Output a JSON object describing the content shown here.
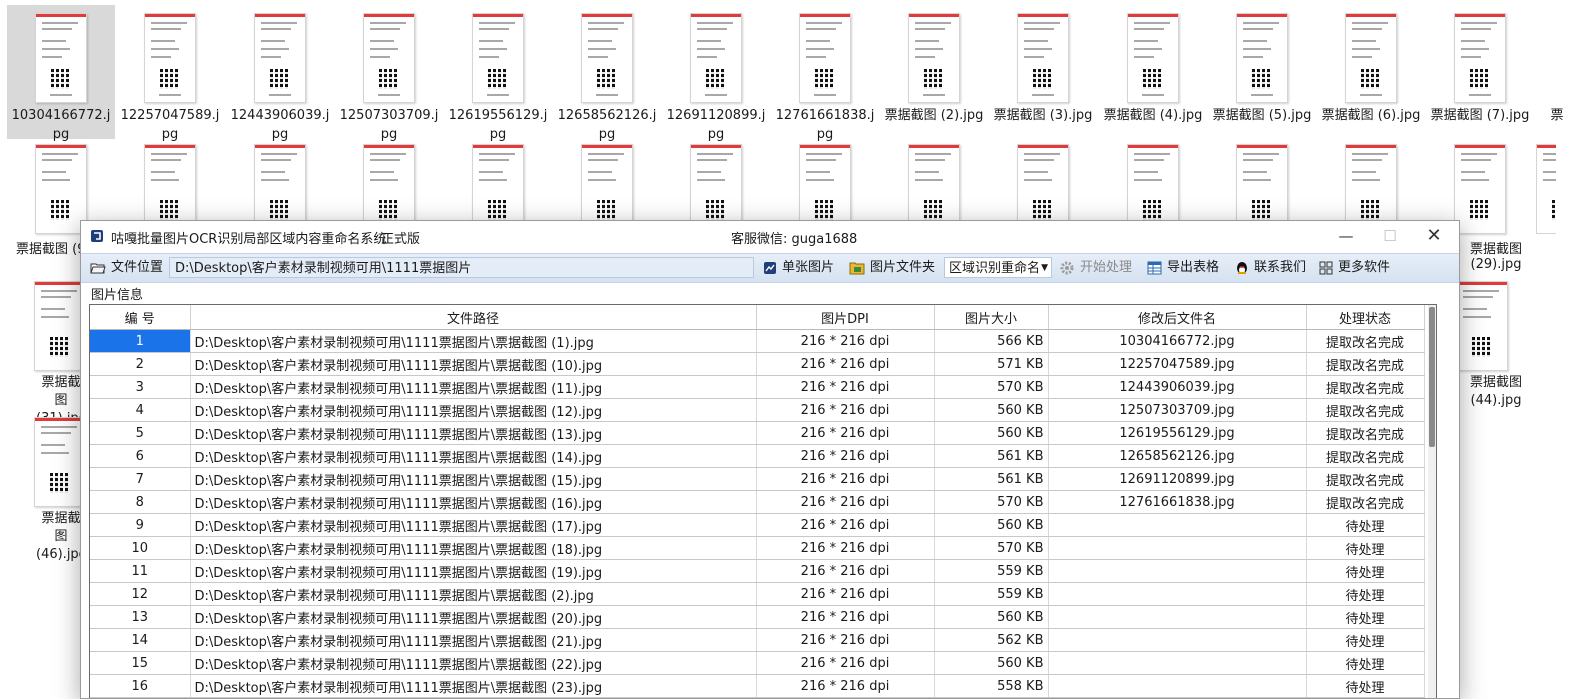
{
  "explorer": {
    "row1": [
      {
        "name": "10304166772.jpg",
        "selected": true
      },
      {
        "name": "12257047589.jpg"
      },
      {
        "name": "12443906039.jpg"
      },
      {
        "name": "12507303709.jpg"
      },
      {
        "name": "12619556129.jpg"
      },
      {
        "name": "12658562126.jpg"
      },
      {
        "name": "12691120899.jpg"
      },
      {
        "name": "12761661838.jpg"
      },
      {
        "name": "票据截图 (2).jpg"
      },
      {
        "name": "票据截图 (3).jpg"
      },
      {
        "name": "票据截图 (4).jpg"
      },
      {
        "name": "票据截图 (5).jpg"
      },
      {
        "name": "票据截图 (6).jpg"
      },
      {
        "name": "票据截图 (7).jpg"
      },
      {
        "name": "票"
      }
    ],
    "row2_left_label": "票据截图 (9",
    "row2_right_label": "票据截图 (29).jpg",
    "row3_left_label": "票据截图 (31).jpg",
    "row3_right_label": "票据截图 (44).jpg",
    "row4_left_label": "票据截图 (46).jpg"
  },
  "dialog": {
    "title": "咕嘎批量图片OCR识别局部区域内容重命名系统",
    "edition": "正式版",
    "wechat": "客服微信: guga1688",
    "toolbar": {
      "file_location_label": "文件位置",
      "path_value": "D:\\Desktop\\客户素材录制视频可用\\1111票据图片",
      "single_image_label": "单张图片",
      "image_folder_label": "图片文件夹",
      "mode_value": "区域识别重命名",
      "start_label": "开始处理",
      "export_label": "导出表格",
      "contact_label": "联系我们",
      "more_label": "更多软件"
    },
    "section_label": "图片信息",
    "columns": [
      "编 号",
      "文件路径",
      "图片DPI",
      "图片大小",
      "修改后文件名",
      "处理状态"
    ],
    "rows": [
      {
        "no": "1",
        "path": "D:\\Desktop\\客户素材录制视频可用\\1111票据图片\\票据截图 (1).jpg",
        "dpi": "216 * 216 dpi",
        "size": "566 KB",
        "newname": "10304166772.jpg",
        "status": "提取改名完成"
      },
      {
        "no": "2",
        "path": "D:\\Desktop\\客户素材录制视频可用\\1111票据图片\\票据截图 (10).jpg",
        "dpi": "216 * 216 dpi",
        "size": "571 KB",
        "newname": "12257047589.jpg",
        "status": "提取改名完成"
      },
      {
        "no": "3",
        "path": "D:\\Desktop\\客户素材录制视频可用\\1111票据图片\\票据截图 (11).jpg",
        "dpi": "216 * 216 dpi",
        "size": "570 KB",
        "newname": "12443906039.jpg",
        "status": "提取改名完成"
      },
      {
        "no": "4",
        "path": "D:\\Desktop\\客户素材录制视频可用\\1111票据图片\\票据截图 (12).jpg",
        "dpi": "216 * 216 dpi",
        "size": "560 KB",
        "newname": "12507303709.jpg",
        "status": "提取改名完成"
      },
      {
        "no": "5",
        "path": "D:\\Desktop\\客户素材录制视频可用\\1111票据图片\\票据截图 (13).jpg",
        "dpi": "216 * 216 dpi",
        "size": "560 KB",
        "newname": "12619556129.jpg",
        "status": "提取改名完成"
      },
      {
        "no": "6",
        "path": "D:\\Desktop\\客户素材录制视频可用\\1111票据图片\\票据截图 (14).jpg",
        "dpi": "216 * 216 dpi",
        "size": "561 KB",
        "newname": "12658562126.jpg",
        "status": "提取改名完成"
      },
      {
        "no": "7",
        "path": "D:\\Desktop\\客户素材录制视频可用\\1111票据图片\\票据截图 (15).jpg",
        "dpi": "216 * 216 dpi",
        "size": "561 KB",
        "newname": "12691120899.jpg",
        "status": "提取改名完成"
      },
      {
        "no": "8",
        "path": "D:\\Desktop\\客户素材录制视频可用\\1111票据图片\\票据截图 (16).jpg",
        "dpi": "216 * 216 dpi",
        "size": "570 KB",
        "newname": "12761661838.jpg",
        "status": "提取改名完成"
      },
      {
        "no": "9",
        "path": "D:\\Desktop\\客户素材录制视频可用\\1111票据图片\\票据截图 (17).jpg",
        "dpi": "216 * 216 dpi",
        "size": "560 KB",
        "newname": "",
        "status": "待处理"
      },
      {
        "no": "10",
        "path": "D:\\Desktop\\客户素材录制视频可用\\1111票据图片\\票据截图 (18).jpg",
        "dpi": "216 * 216 dpi",
        "size": "570 KB",
        "newname": "",
        "status": "待处理"
      },
      {
        "no": "11",
        "path": "D:\\Desktop\\客户素材录制视频可用\\1111票据图片\\票据截图 (19).jpg",
        "dpi": "216 * 216 dpi",
        "size": "559 KB",
        "newname": "",
        "status": "待处理"
      },
      {
        "no": "12",
        "path": "D:\\Desktop\\客户素材录制视频可用\\1111票据图片\\票据截图 (2).jpg",
        "dpi": "216 * 216 dpi",
        "size": "559 KB",
        "newname": "",
        "status": "待处理"
      },
      {
        "no": "13",
        "path": "D:\\Desktop\\客户素材录制视频可用\\1111票据图片\\票据截图 (20).jpg",
        "dpi": "216 * 216 dpi",
        "size": "560 KB",
        "newname": "",
        "status": "待处理"
      },
      {
        "no": "14",
        "path": "D:\\Desktop\\客户素材录制视频可用\\1111票据图片\\票据截图 (21).jpg",
        "dpi": "216 * 216 dpi",
        "size": "562 KB",
        "newname": "",
        "status": "待处理"
      },
      {
        "no": "15",
        "path": "D:\\Desktop\\客户素材录制视频可用\\1111票据图片\\票据截图 (22).jpg",
        "dpi": "216 * 216 dpi",
        "size": "560 KB",
        "newname": "",
        "status": "待处理"
      },
      {
        "no": "16",
        "path": "D:\\Desktop\\客户素材录制视频可用\\1111票据图片\\票据截图 (23).jpg",
        "dpi": "216 * 216 dpi",
        "size": "558 KB",
        "newname": "",
        "status": "待处理"
      }
    ]
  },
  "colors": {
    "accent": "#1a73e8",
    "toolbar": "#dde7f4",
    "red_band": "#e03a3a"
  }
}
